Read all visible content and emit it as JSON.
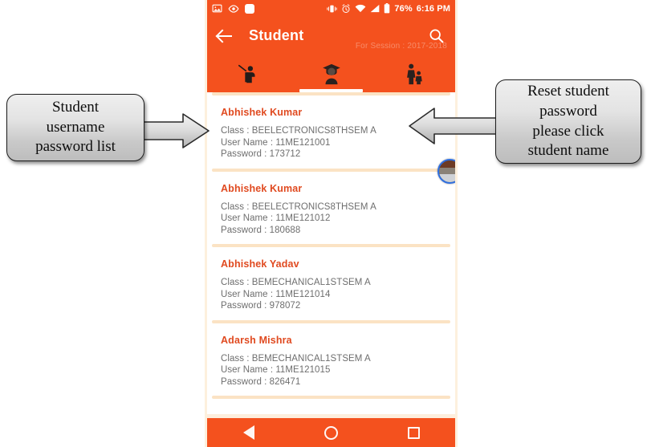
{
  "statusbar": {
    "icons_left": [
      "image-icon",
      "eye-icon",
      "rounded-square-icon"
    ],
    "icons_right": [
      "vibrate-icon",
      "alarm-icon",
      "wifi-icon",
      "signal-icon",
      "battery-icon"
    ],
    "battery_percent": "76%",
    "time": "6:16 PM"
  },
  "appbar": {
    "back_icon": "back-arrow-icon",
    "title": "Student",
    "session": "For Session : 2017-2018",
    "search_icon": "search-icon"
  },
  "tabs": [
    {
      "icon": "teacher-icon",
      "selected": false
    },
    {
      "icon": "graduate-student-icon",
      "selected": true
    },
    {
      "icon": "parent-child-icon",
      "selected": false
    }
  ],
  "list": {
    "labels": {
      "class": "Class : ",
      "username": "User Name : ",
      "password": "Password : "
    },
    "students": [
      {
        "name": "Abhishek Kumar",
        "class_line": "Class : BEELECTRONICS8THSEM A",
        "username_line": "User Name : 11ME121001",
        "password_line": "Password : 173712"
      },
      {
        "name": "Abhishek Kumar",
        "class_line": "Class : BEELECTRONICS8THSEM A",
        "username_line": "User Name : 11ME121012",
        "password_line": "Password : 180688"
      },
      {
        "name": "Abhishek Yadav",
        "class_line": "Class : BEMECHANICAL1STSEM A",
        "username_line": "User Name : 11ME121014",
        "password_line": "Password : 978072"
      },
      {
        "name": "Adarsh Mishra",
        "class_line": "Class : BEMECHANICAL1STSEM A",
        "username_line": "User Name : 11ME121015",
        "password_line": "Password : 826471"
      }
    ]
  },
  "avatar": {
    "icon": "user-avatar-icon"
  },
  "navbar": {
    "back": "back-triangle-icon",
    "home": "home-circle-icon",
    "recents": "recents-square-icon"
  },
  "annotations": {
    "left_callout": {
      "lines": [
        "Student",
        "username",
        "password list"
      ]
    },
    "right_callout": {
      "lines": [
        "Reset student",
        "password",
        "please click",
        "student name"
      ]
    },
    "left_arrow": "right-pointing-arrow-icon",
    "right_arrow": "left-pointing-arrow-icon"
  },
  "colors": {
    "accent_orange": "#f4511e",
    "name_red": "#e04a20",
    "divider_peach": "#fbe3c4",
    "body_gray": "#6e6e6e",
    "callout_border": "#1c1c1c"
  }
}
